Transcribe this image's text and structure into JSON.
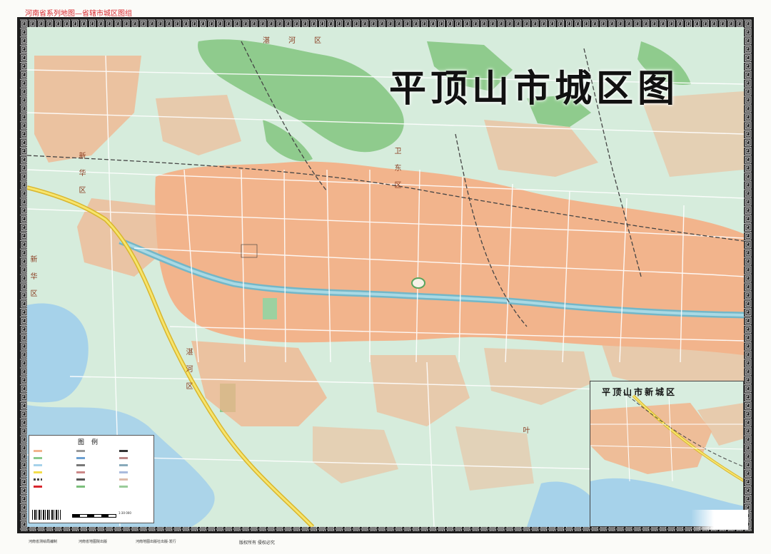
{
  "series_title": "河南省系列地图—省辖市城区图组",
  "title": "平顶山市城区图",
  "inset_title": "平顶山市新城区",
  "legend": {
    "title": "图例",
    "scale_text": "1:30 000"
  },
  "district_labels": {
    "top": "湛河区",
    "weihe": "卫东区",
    "xinhua_left": "新华区",
    "xinhua_lower": "新华区",
    "zhanhe_lower": "湛河区",
    "ye": "叶"
  },
  "imprint": {
    "editor": "河南省测绘局编制",
    "distributor": "河南省地图院出版",
    "press": "河南地图出版社出版·发行",
    "rights": "版权所有 侵权必究"
  },
  "colors": {
    "urban": "#f2b48c",
    "green": "#88c98a",
    "water": "#a6d2ea",
    "background": "#d6ecdc",
    "railway": "#444444",
    "highway": "#f3dd4a",
    "frame": "#1d1d1d",
    "series_title": "#d8262d"
  },
  "icons": [
    "frame-fret-pattern",
    "north-arrow-icon",
    "barcode-icon"
  ]
}
